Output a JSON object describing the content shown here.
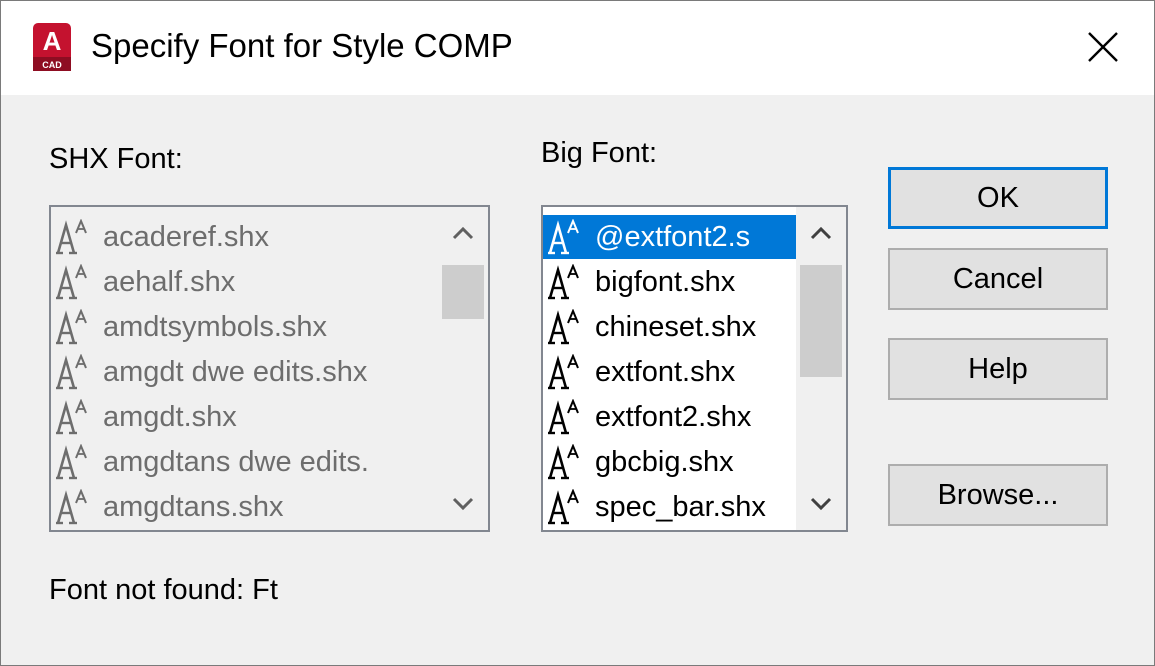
{
  "window": {
    "title": "Specify Font for Style COMP",
    "app_icon_letter": "A",
    "app_icon_sub": "CAD",
    "app_icon_color": "#c4122f"
  },
  "shx_font": {
    "label": "SHX Font:",
    "items": [
      "acaderef.shx",
      "aehalf.shx",
      "amdtsymbols.shx",
      "amgdt dwe edits.shx",
      "amgdt.shx",
      "amgdtans dwe edits.",
      "amgdtans.shx"
    ],
    "item_icon": "shx-font-icon",
    "enabled": false
  },
  "big_font": {
    "label": "Big Font:",
    "items": [
      "@extfont2.s",
      "bigfont.shx",
      "chineset.shx",
      "extfont.shx",
      "extfont2.shx",
      "gbcbig.shx",
      "spec_bar.shx"
    ],
    "selected_index": 0,
    "item_icon": "shx-font-icon",
    "enabled": true
  },
  "buttons": {
    "ok": "OK",
    "cancel": "Cancel",
    "help": "Help",
    "browse": "Browse..."
  },
  "status": {
    "text": "Font not found: Ft"
  },
  "colors": {
    "selection": "#0078d7",
    "default_button_border": "#0078d7",
    "disabled_text": "#6d6d6d",
    "dialog_bg": "#f0f0f0"
  }
}
